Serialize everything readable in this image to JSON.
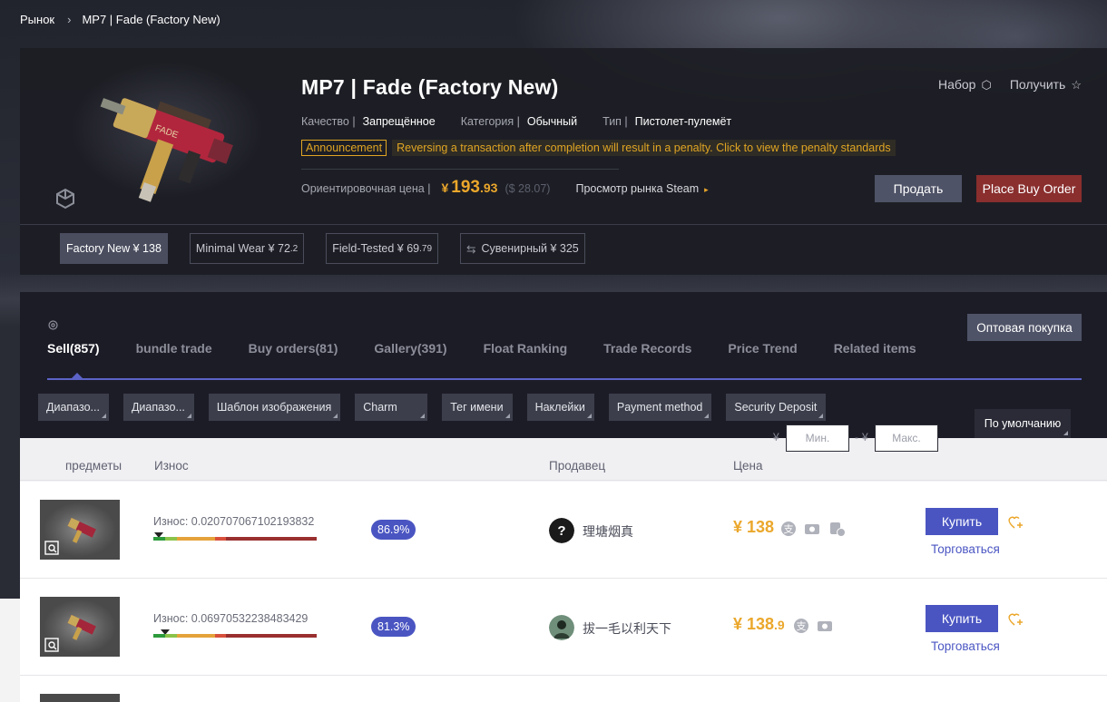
{
  "breadcrumb": {
    "root": "Рынок",
    "current": "MP7 | Fade (Factory New)"
  },
  "item": {
    "title": "MP7 | Fade (Factory New)",
    "quality_label": "Качество |",
    "quality_value": "Запрещённое",
    "category_label": "Категория |",
    "category_value": "Обычный",
    "type_label": "Тип |",
    "type_value": "Пистолет-пулемёт"
  },
  "announcement": {
    "tag": "Announcement",
    "text": "Reversing a transaction after completion will result in a penalty. Click to view the penalty standards"
  },
  "price": {
    "label": "Ориентировочная цена |",
    "yen": "¥",
    "int": "193",
    "dec": ".93",
    "usd": "($ 28.07)",
    "steam_link": "Просмотр рынка Steam"
  },
  "actions": {
    "kit": "Набор",
    "get": "Получить",
    "sell": "Продать",
    "buy_order": "Place Buy Order"
  },
  "wear_tabs": [
    {
      "label": "Factory New ¥ 138",
      "small": ""
    },
    {
      "label": "Minimal Wear ¥ 72",
      "small": ".2"
    },
    {
      "label": "Field-Tested ¥ 69",
      "small": ".79"
    },
    {
      "label": "Сувенирный ¥ 325",
      "small": ""
    }
  ],
  "bulk_buy": "Оптовая покупка",
  "tabs": [
    "Sell(857)",
    "bundle trade",
    "Buy orders(81)",
    "Gallery(391)",
    "Float Ranking",
    "Trade Records",
    "Price Trend",
    "Related items"
  ],
  "filters": [
    "Диапазо...",
    "Диапазо...",
    "Шаблон изображения",
    "Charm",
    "Тег имени",
    "Наклейки",
    "Payment method",
    "Security Deposit"
  ],
  "price_range": {
    "currency": "¥",
    "min_placeholder": "Мин.",
    "max_placeholder": "Макс.",
    "dash": "-"
  },
  "sort": "По умолчанию",
  "list_headers": {
    "items": "предметы",
    "wear": "Износ",
    "seller": "Продавец",
    "price": "Цена"
  },
  "listings": [
    {
      "wear": "Износ: 0.020707067102193832",
      "wear_value": 0.0207,
      "percent": "86.9%",
      "seller": "理塘烟真",
      "price_int": "¥ 138",
      "price_dec": "",
      "buy": "Купить",
      "bargain": "Торговаться"
    },
    {
      "wear": "Износ: 0.06970532238483429",
      "wear_value": 0.0697,
      "percent": "81.3%",
      "seller": "拔一毛以利天下",
      "price_int": "¥ 138",
      "price_dec": ".9",
      "buy": "Купить",
      "bargain": "Торговаться"
    }
  ],
  "colors": {
    "accent": "#4a55c2",
    "price": "#eba72b",
    "announcement": "#e0a523",
    "buy_order": "#8a2e2e"
  }
}
